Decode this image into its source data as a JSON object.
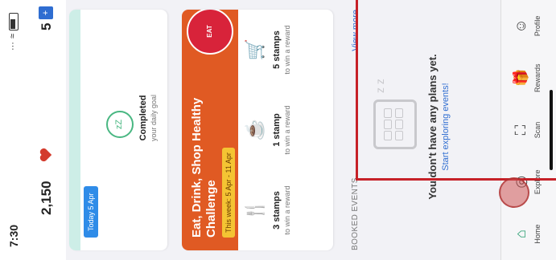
{
  "status": {
    "time": "7:30"
  },
  "header": {
    "points": "2,150",
    "tickets": "5"
  },
  "goal": {
    "date_pill": "Today 5 Apr",
    "title": "Completed",
    "subtitle": "your daily goal",
    "icon": "sleep-zz-icon"
  },
  "challenge": {
    "title": "Eat, Drink, Shop Healthy Challenge",
    "week": "This week: 5 Apr - 11 Apr",
    "logo_text": "EAT",
    "stamps": [
      {
        "title": "3 stamps",
        "desc": "to win a reward",
        "icon": "fork-knife-icon"
      },
      {
        "title": "1 stamp",
        "desc": "to win a reward",
        "icon": "drink-icon"
      },
      {
        "title": "5 stamps",
        "desc": "to win a reward",
        "icon": "shopping-cart-icon"
      }
    ]
  },
  "events": {
    "header": "BOOKED EVENTS",
    "view_more": "View more",
    "empty_title": "You don't have any plans yet.",
    "empty_link": "Start exploring events!"
  },
  "nav": [
    {
      "label": "Home",
      "icon": "home-icon"
    },
    {
      "label": "Explore",
      "icon": "compass-icon"
    },
    {
      "label": "Scan",
      "icon": "scan-icon"
    },
    {
      "label": "Rewards",
      "icon": "gift-icon"
    },
    {
      "label": "Profile",
      "icon": "profile-icon"
    }
  ],
  "colors": {
    "accent": "#2f6dd1",
    "orange": "#e05a23",
    "green": "#1f9a6a",
    "highlight": "#c62128"
  }
}
